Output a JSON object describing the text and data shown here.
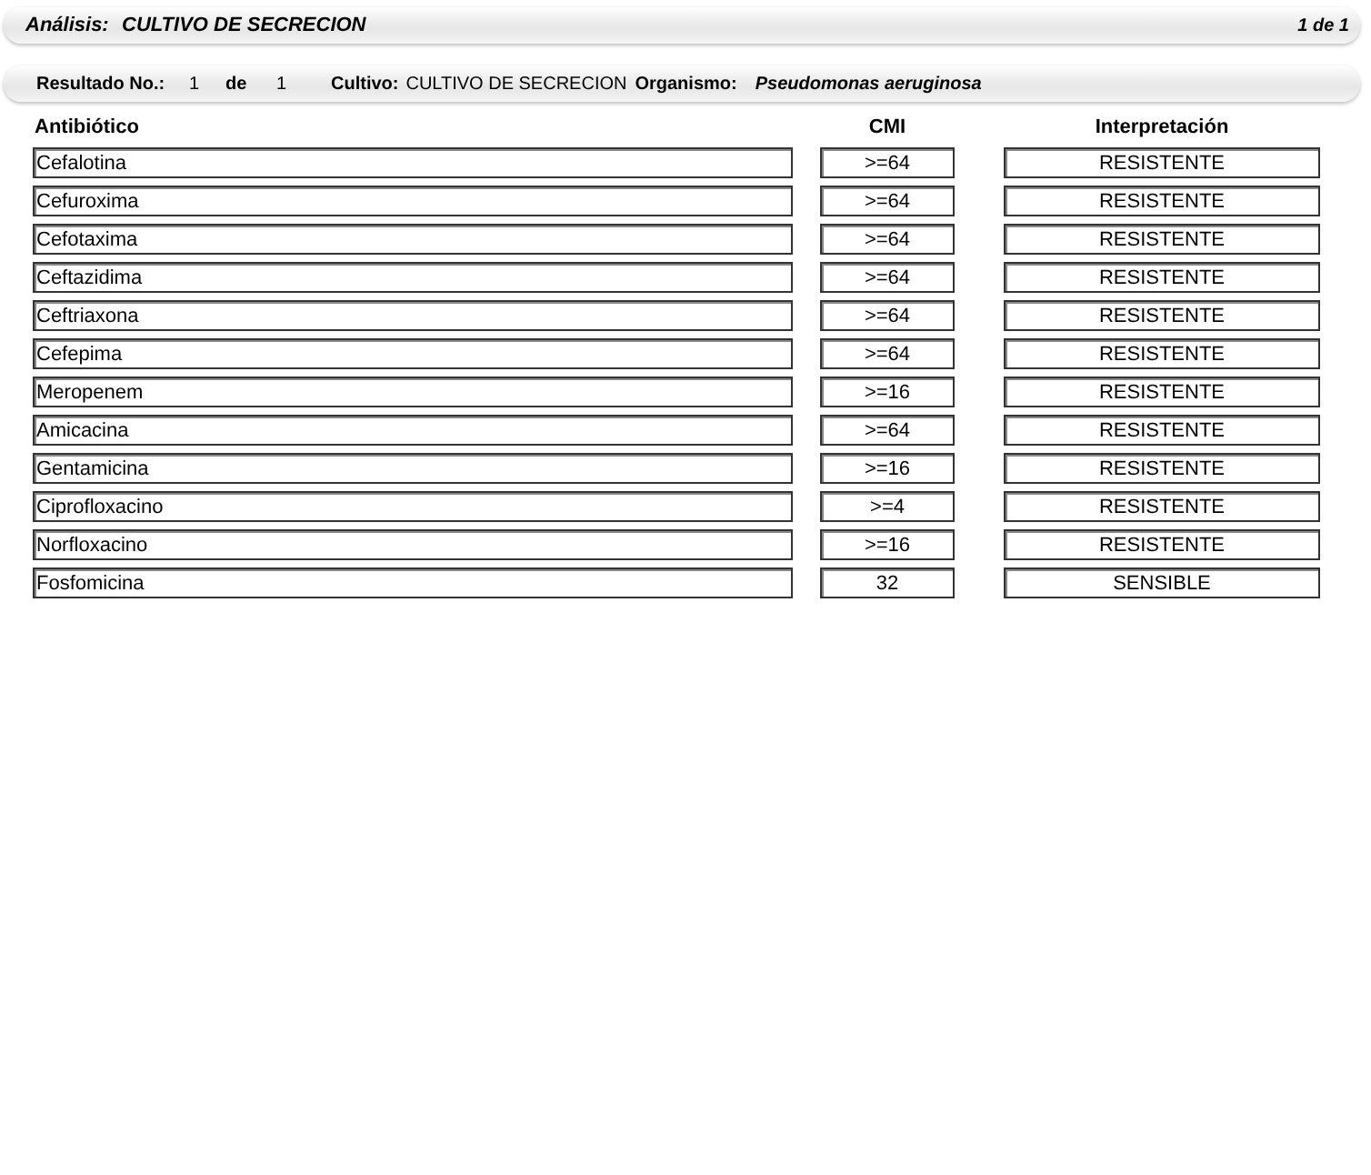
{
  "header": {
    "label": "Análisis:",
    "value": "CULTIVO DE SECRECION",
    "page": "1 de 1"
  },
  "result_bar": {
    "result_label": "Resultado No.:",
    "result_no": "1",
    "of_label": "de",
    "result_total": "1",
    "culture_label": "Cultivo:",
    "culture": "CULTIVO DE SECRECION",
    "organism_label": "Organismo:",
    "organism": "Pseudomonas aeruginosa"
  },
  "table": {
    "columns": [
      "Antibiótico",
      "CMI",
      "Interpretación"
    ],
    "rows": [
      {
        "antibiotic": "Cefalotina",
        "cmi": ">=64",
        "interpretation": "RESISTENTE"
      },
      {
        "antibiotic": "Cefuroxima",
        "cmi": ">=64",
        "interpretation": "RESISTENTE"
      },
      {
        "antibiotic": "Cefotaxima",
        "cmi": ">=64",
        "interpretation": "RESISTENTE"
      },
      {
        "antibiotic": "Ceftazidima",
        "cmi": ">=64",
        "interpretation": "RESISTENTE"
      },
      {
        "antibiotic": "Ceftriaxona",
        "cmi": ">=64",
        "interpretation": "RESISTENTE"
      },
      {
        "antibiotic": "Cefepima",
        "cmi": ">=64",
        "interpretation": "RESISTENTE"
      },
      {
        "antibiotic": "Meropenem",
        "cmi": ">=16",
        "interpretation": "RESISTENTE"
      },
      {
        "antibiotic": "Amicacina",
        "cmi": ">=64",
        "interpretation": "RESISTENTE"
      },
      {
        "antibiotic": "Gentamicina",
        "cmi": ">=16",
        "interpretation": "RESISTENTE"
      },
      {
        "antibiotic": "Ciprofloxacino",
        "cmi": ">=4",
        "interpretation": "RESISTENTE"
      },
      {
        "antibiotic": "Norfloxacino",
        "cmi": ">=16",
        "interpretation": "RESISTENTE"
      },
      {
        "antibiotic": "Fosfomicina",
        "cmi": "32",
        "interpretation": "SENSIBLE"
      }
    ]
  }
}
